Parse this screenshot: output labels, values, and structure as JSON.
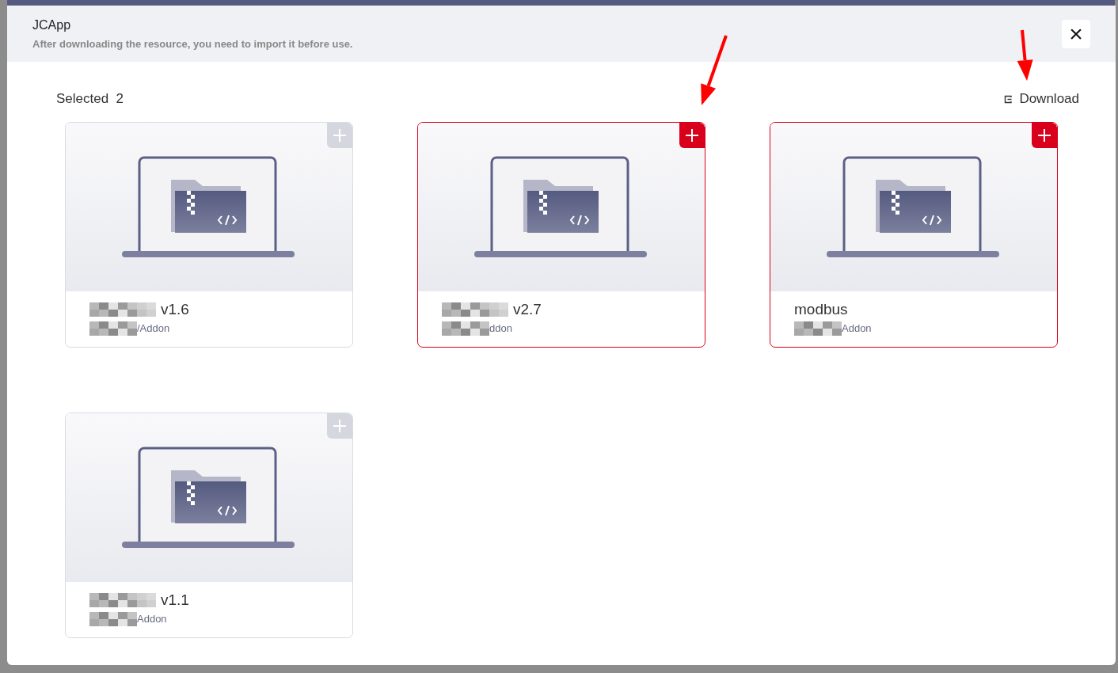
{
  "dialog": {
    "title": "JCApp",
    "subtitle": "After downloading the resource, you need to import it before use.",
    "close": "×"
  },
  "toolbar": {
    "selected_label": "Selected",
    "selected_count": "2",
    "download": "Download"
  },
  "cards": [
    {
      "name": "v1.6",
      "path": "/Addon",
      "name_redacted": true,
      "path_redacted": true,
      "selected": false
    },
    {
      "name": "v2.7",
      "path": "ddon",
      "name_redacted": true,
      "path_redacted": true,
      "selected": true
    },
    {
      "name": "modbus",
      "path": "Addon",
      "name_redacted": false,
      "path_redacted": true,
      "selected": true
    },
    {
      "name": "v1.1",
      "path": "Addon",
      "name_redacted": true,
      "path_redacted": true,
      "selected": false
    }
  ],
  "annotations": [
    {
      "kind": "arrow"
    },
    {
      "kind": "arrow"
    }
  ]
}
